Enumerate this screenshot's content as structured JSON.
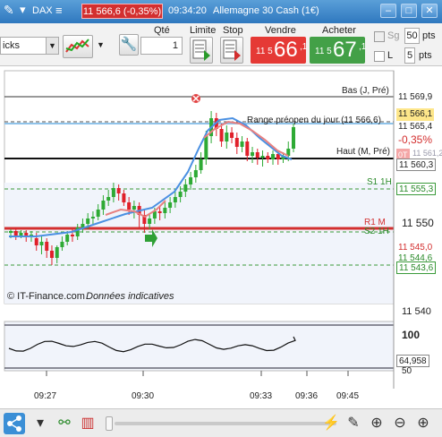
{
  "titlebar": {
    "instrument": "DAX",
    "last_price": "11 566,6 (-0,35%)",
    "time": "09:34:20",
    "name": "Allemagne 30 Cash (1€)"
  },
  "toolbar": {
    "interval_select": "icks",
    "qty_label": "Qté",
    "qty_value": "1",
    "limit_label": "Limite",
    "stop_label": "Stop",
    "sell_label": "Vendre",
    "sell_prefix": "11 5",
    "sell_big": "66",
    "sell_suffix": ",1",
    "buy_label": "Acheter",
    "buy_prefix": "11 5",
    "buy_big": "67",
    "buy_suffix": ",1",
    "sg_label": "Sg",
    "sg_value": "50",
    "sg_unit": "pts",
    "l_label": "L",
    "l_value": "5",
    "l_unit": "pts"
  },
  "chart": {
    "overlays": {
      "bas": "Bas (J, Pré)",
      "range": "Range préopen du jour (11 566,6)",
      "haut": "Haut (M, Pré)",
      "s1": "S1 1H",
      "r1": "R1 M",
      "s2": "S2 1H"
    },
    "price_tags": {
      "p1": "11 569,9",
      "p2": "11 566,1",
      "p3": "11 565,4",
      "change": "-0,35%",
      "ot": "0T",
      "p4": "11 561,2",
      "p5": "11 560,3",
      "p6": "11 555,3",
      "p7": "11 550",
      "p8": "11 545,0",
      "p9": "11 544,6",
      "p10": "11 543,6",
      "p11": "11 540"
    },
    "watermark": "© IT-Finance.com",
    "disclaimer": "Données indicatives",
    "oscillator": {
      "top": "100",
      "value": "64,958",
      "mid": "50"
    },
    "x_labels": [
      "09:27",
      "09:30",
      "09:33",
      "09:36",
      "09:45"
    ],
    "colors": {
      "up": "#2eaa35",
      "down": "#e0202a",
      "ma_blue": "#4a90e2",
      "ma_red": "#e88080",
      "sell": "#e53935",
      "buy": "#43a047"
    }
  }
}
